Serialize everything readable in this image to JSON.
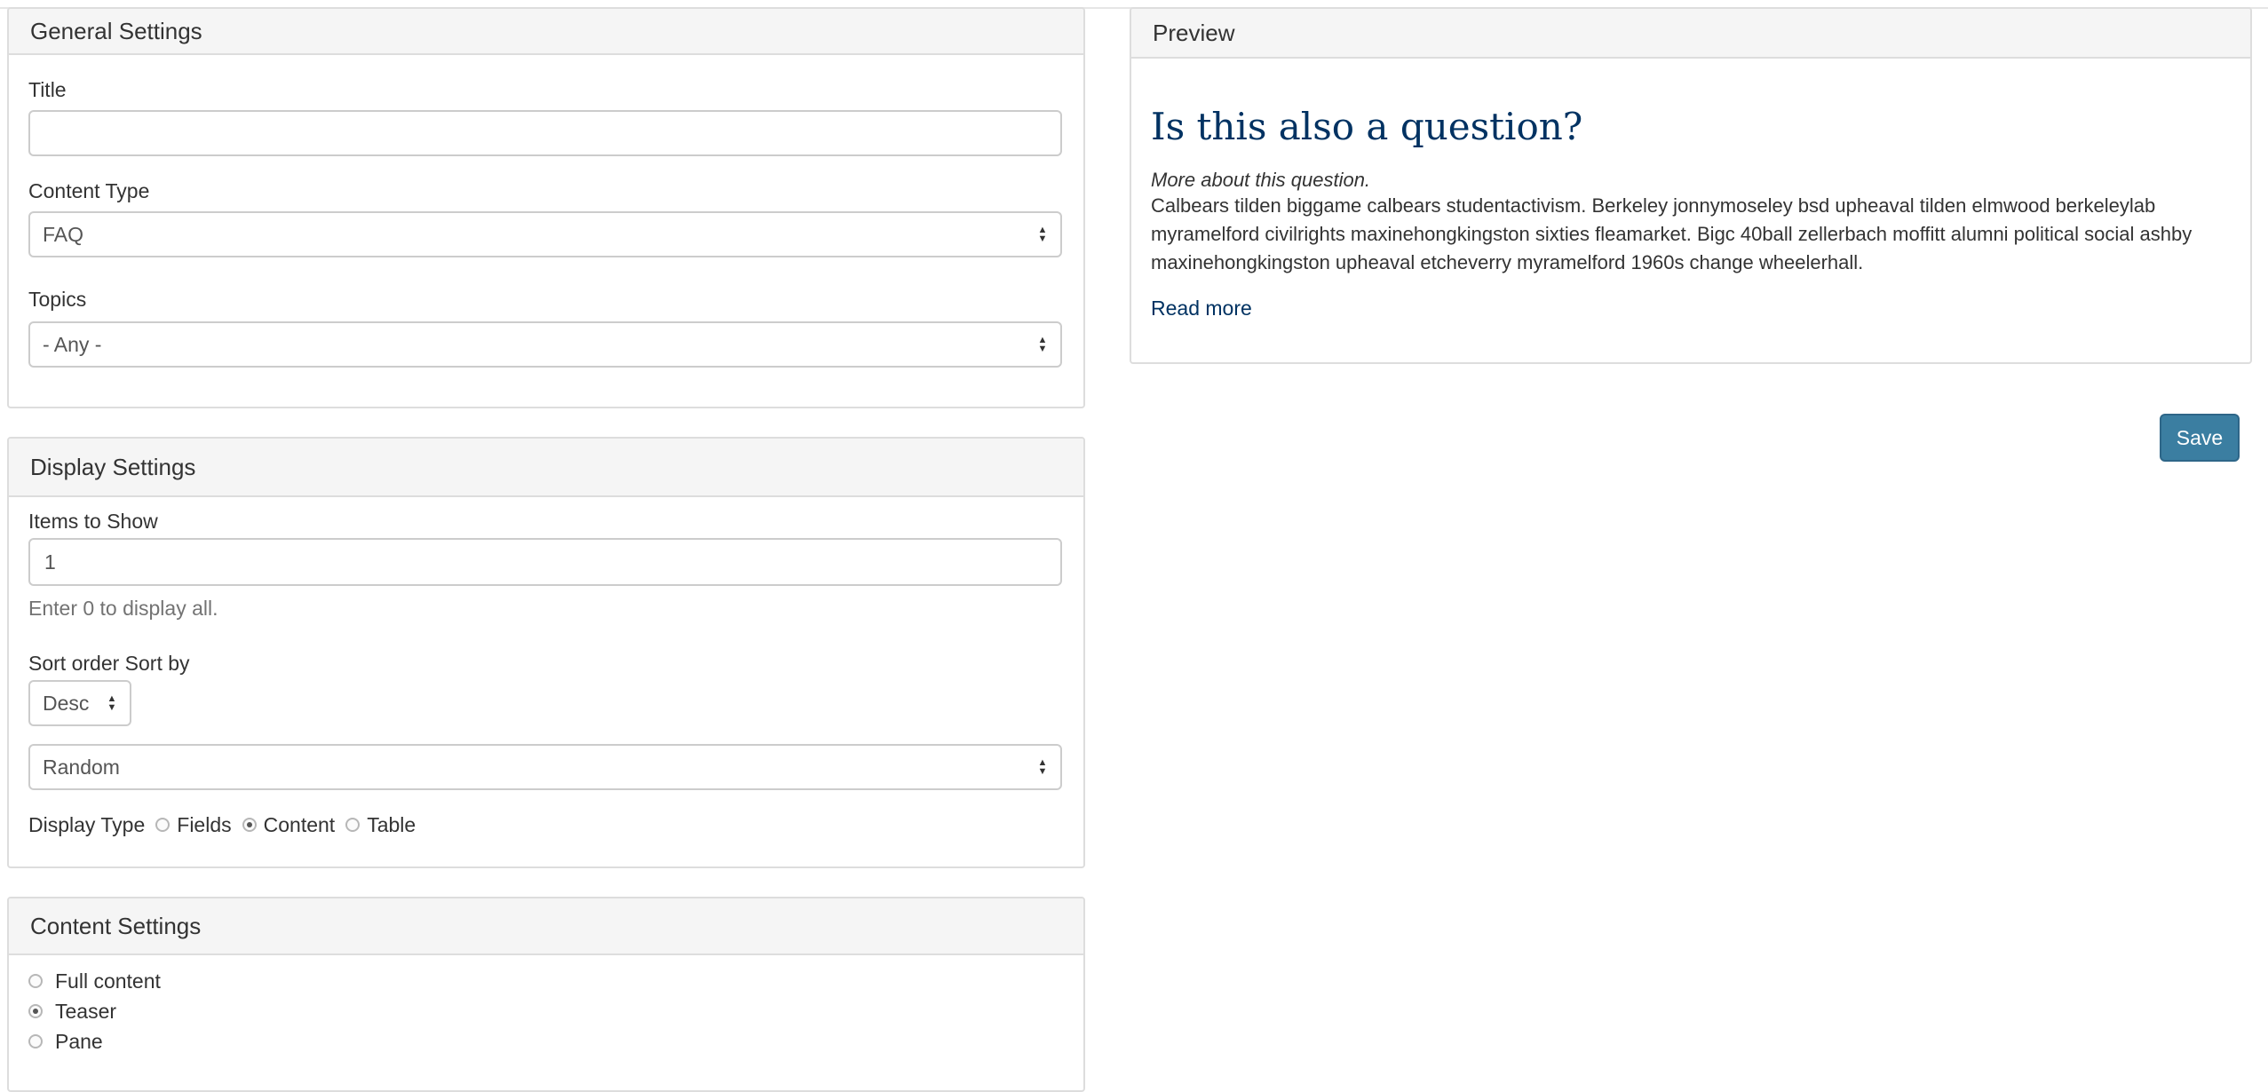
{
  "general_settings": {
    "heading": "General Settings",
    "title_label": "Title",
    "title_value": "",
    "content_type_label": "Content Type",
    "content_type_value": "FAQ",
    "topics_label": "Topics",
    "topics_value": "- Any -"
  },
  "display_settings": {
    "heading": "Display Settings",
    "items_label": "Items to Show",
    "items_value": "1",
    "items_help": "Enter 0 to display all.",
    "sort_label": "Sort order Sort by",
    "sort_order_value": "Desc",
    "sort_by_value": "Random",
    "display_type_label": "Display Type",
    "display_type_options": [
      {
        "label": "Fields",
        "checked": false
      },
      {
        "label": "Content",
        "checked": true
      },
      {
        "label": "Table",
        "checked": false
      }
    ]
  },
  "content_settings": {
    "heading": "Content Settings",
    "options": [
      {
        "label": "Full content",
        "checked": false
      },
      {
        "label": "Teaser",
        "checked": true
      },
      {
        "label": "Pane",
        "checked": false
      }
    ]
  },
  "preview": {
    "heading": "Preview",
    "title": "Is this also a question?",
    "subtitle": "More about this question.",
    "body": "Calbears tilden biggame calbears studentactivism. Berkeley jonnymoseley bsd upheaval tilden elmwood berkeleylab myramelford civilrights maxinehongkingston sixties fleamarket. Bigc 40ball zellerbach moffitt alumni political social ashby maxinehongkingston upheaval etcheverry myramelford 1960s change wheelerhall.",
    "read_more": "Read more"
  },
  "actions": {
    "save_label": "Save"
  },
  "colors": {
    "link": "#003262",
    "save_button": "#3b7ea1",
    "panel_heading_bg": "#f5f5f5",
    "border": "#dddddd"
  }
}
